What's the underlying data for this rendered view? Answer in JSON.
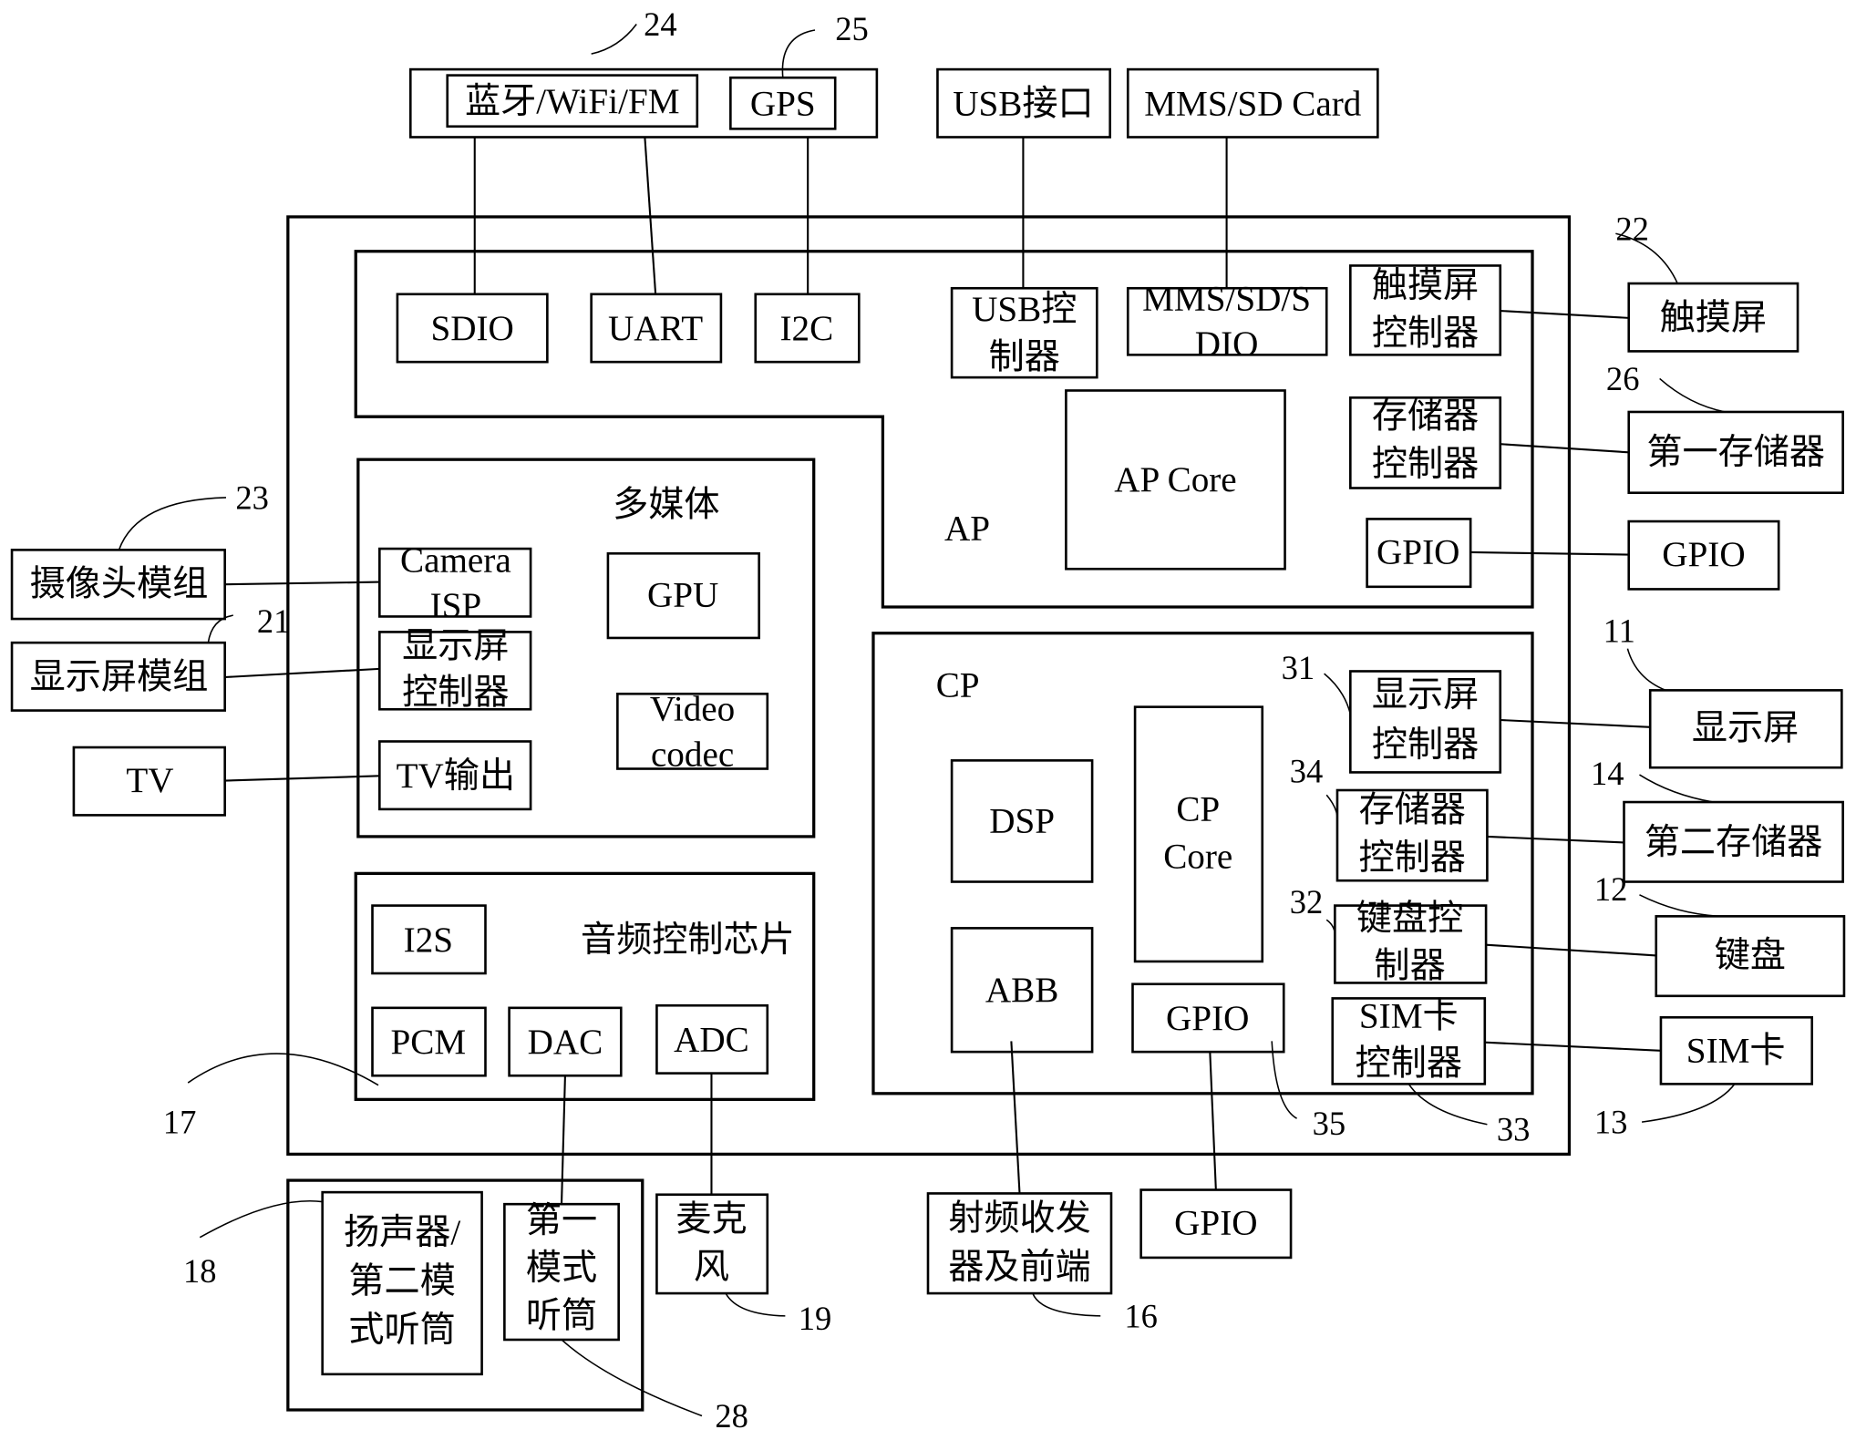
{
  "figure": {
    "external_top": {
      "wireless_group": {
        "bt_wifi_fm": "蓝牙/WiFi/FM",
        "gps": "GPS"
      },
      "usb_port": "USB接口",
      "mms_sd_card": "MMS/SD Card"
    },
    "ap": {
      "label": "AP",
      "sdio": "SDIO",
      "uart": "UART",
      "i2c": "I2C",
      "usb_ctrl": [
        "USB控",
        "制器"
      ],
      "mms_sd_sdio": [
        "MMS/SD/S",
        "DIO"
      ],
      "touch_ctrl": [
        "触摸屏",
        "控制器"
      ],
      "mem_ctrl": [
        "存储器",
        "控制器"
      ],
      "ap_core": "AP Core",
      "gpio": "GPIO"
    },
    "multimedia": {
      "label": "多媒体",
      "camera_isp": [
        "Camera",
        "ISP"
      ],
      "display_ctrl": [
        "显示屏",
        "控制器"
      ],
      "tv_out": "TV输出",
      "gpu": "GPU",
      "video_codec": [
        "Video",
        "codec"
      ]
    },
    "audio": {
      "label": "音频控制芯片",
      "i2s": "I2S",
      "pcm": "PCM",
      "dac": "DAC",
      "adc": "ADC"
    },
    "cp": {
      "label": "CP",
      "dsp": "DSP",
      "abb": "ABB",
      "cp_core": [
        "CP",
        "Core"
      ],
      "gpio": "GPIO",
      "display_ctrl": [
        "显示屏",
        "控制器"
      ],
      "mem_ctrl": [
        "存储器",
        "控制器"
      ],
      "keypad_ctrl": [
        "键盘控",
        "制器"
      ],
      "sim_ctrl": [
        "SIM卡",
        "控制器"
      ]
    },
    "external_left": {
      "camera_module": "摄像头模组",
      "display_module": "显示屏模组",
      "tv": "TV"
    },
    "external_right": {
      "touchscreen": "触摸屏",
      "first_memory": "第一存储器",
      "gpio": "GPIO",
      "display": "显示屏",
      "second_memory": "第二存储器",
      "keypad": "键盘",
      "sim_card": "SIM卡"
    },
    "external_bottom": {
      "speaker": [
        "扬声器/",
        "第二模",
        "式听筒"
      ],
      "first_receiver": [
        "第一",
        "模式",
        "听筒"
      ],
      "microphone": [
        "麦克",
        "风"
      ],
      "rf": [
        "射频收发",
        "器及前端"
      ],
      "gpio": "GPIO"
    },
    "ref_numbers": {
      "n24": "24",
      "n25": "25",
      "n22": "22",
      "n26": "26",
      "n23": "23",
      "n21": "21",
      "n11": "11",
      "n14": "14",
      "n12": "12",
      "n13": "13",
      "n31": "31",
      "n34": "34",
      "n32": "32",
      "n33": "33",
      "n35": "35",
      "n17": "17",
      "n18": "18",
      "n19": "19",
      "n16": "16",
      "n28": "28"
    }
  }
}
